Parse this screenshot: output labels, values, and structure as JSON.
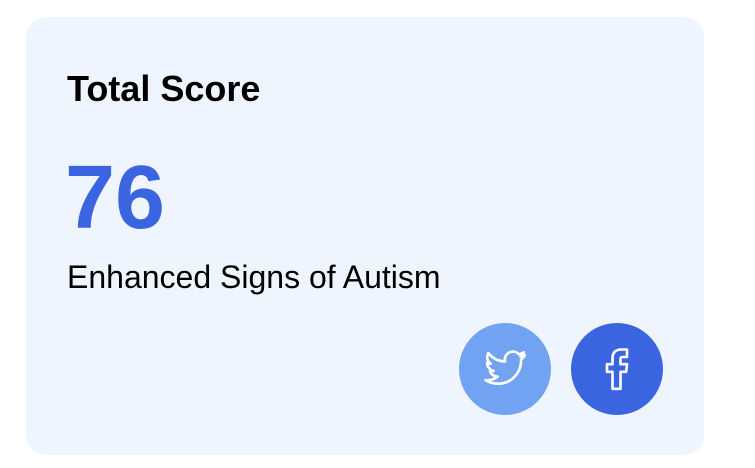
{
  "card": {
    "title": "Total Score",
    "score": "76",
    "result_label": "Enhanced Signs of Autism"
  },
  "share": {
    "buttons": [
      {
        "network": "twitter",
        "icon": "twitter-icon",
        "color": "#72a2f2"
      },
      {
        "network": "facebook",
        "icon": "facebook-icon",
        "color": "#3b64e0"
      }
    ]
  },
  "colors": {
    "card_background": "#eff5fe",
    "score_accent": "#3b64e0",
    "text": "#000000"
  }
}
